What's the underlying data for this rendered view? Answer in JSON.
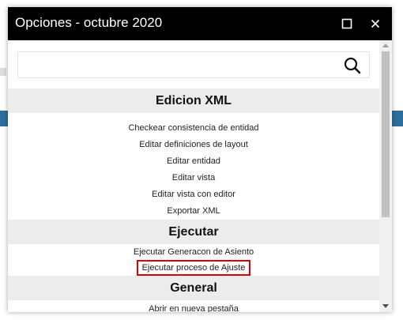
{
  "dialog": {
    "title": "Opciones - octubre 2020"
  },
  "search": {
    "value": "",
    "placeholder": ""
  },
  "sections": [
    {
      "title": "Edicion XML",
      "items": [
        "Checkear consistencia de entidad",
        "Editar definiciones de layout",
        "Editar entidad",
        "Editar vista",
        "Editar vista con editor",
        "Exportar XML"
      ]
    },
    {
      "title": "Ejecutar",
      "items": [
        "Ejecutar Generacon de Asiento",
        "Ejecutar proceso de Ajuste"
      ]
    },
    {
      "title": "General",
      "items": [
        "Abrir en nueva pestaña"
      ]
    }
  ],
  "highlighted_item": "Ejecutar proceso de Ajuste",
  "colors": {
    "titlebar": "#000000",
    "section_bg": "#ececec",
    "highlight_border": "#e00000",
    "background_strip": "#2f6f9a"
  }
}
